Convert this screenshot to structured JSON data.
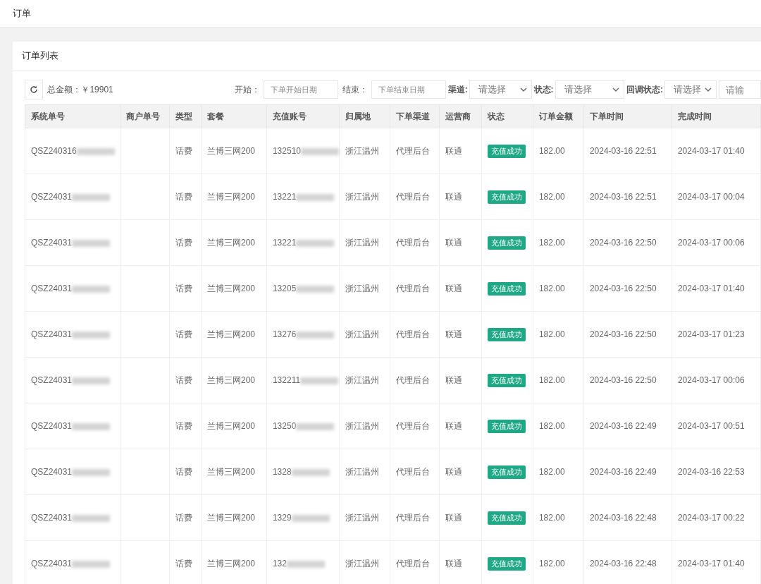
{
  "page_title": "订单",
  "card": {
    "title": "订单列表",
    "total": "总金额：￥19901",
    "filters": [
      {
        "kind": "date",
        "label": "开始：",
        "placeholder": "下单开始日期"
      },
      {
        "kind": "date",
        "label": "结束：",
        "placeholder": "下单结束日期"
      },
      {
        "kind": "select",
        "label": "渠道:",
        "value": "请选择"
      },
      {
        "kind": "select",
        "label": "状态:",
        "value": "请选择"
      },
      {
        "kind": "select",
        "label": "回调状态:",
        "value": "请选择"
      },
      {
        "kind": "input",
        "placeholder": "请输"
      }
    ]
  },
  "table": {
    "columns": [
      {
        "label": "系统单号",
        "kind": "masked"
      },
      {
        "label": "商户单号",
        "kind": "text"
      },
      {
        "label": "类型",
        "kind": "text"
      },
      {
        "label": "套餐",
        "kind": "text"
      },
      {
        "label": "充值账号",
        "kind": "masked"
      },
      {
        "label": "归属地",
        "kind": "text"
      },
      {
        "label": "下单渠道",
        "kind": "text"
      },
      {
        "label": "运营商",
        "kind": "text"
      },
      {
        "label": "状态",
        "kind": "badge"
      },
      {
        "label": "订单金额",
        "kind": "text"
      },
      {
        "label": "下单时间",
        "kind": "text"
      },
      {
        "label": "完成时间",
        "kind": "text"
      }
    ],
    "rows": [
      {
        "masked": true,
        "cells": [
          "QSZ240316",
          null,
          "话费",
          "兰博三网200",
          "132510",
          "浙江温州",
          "代理后台",
          "联通",
          "充值成功",
          "182.00",
          "2024-03-16 22:51",
          "2024-03-17 01:40"
        ]
      },
      {
        "masked": true,
        "cells": [
          "QSZ24031",
          null,
          "话费",
          "兰博三网200",
          "13221",
          "浙江温州",
          "代理后台",
          "联通",
          "充值成功",
          "182.00",
          "2024-03-16 22:51",
          "2024-03-17 00:04"
        ]
      },
      {
        "masked": true,
        "cells": [
          "QSZ24031",
          null,
          "话费",
          "兰博三网200",
          "13221",
          "浙江温州",
          "代理后台",
          "联通",
          "充值成功",
          "182.00",
          "2024-03-16 22:50",
          "2024-03-17 00:06"
        ]
      },
      {
        "masked": true,
        "cells": [
          "QSZ24031",
          null,
          "话费",
          "兰博三网200",
          "13205",
          "浙江温州",
          "代理后台",
          "联通",
          "充值成功",
          "182.00",
          "2024-03-16 22:50",
          "2024-03-17 01:40"
        ]
      },
      {
        "masked": true,
        "cells": [
          "QSZ24031",
          null,
          "话费",
          "兰博三网200",
          "13276",
          "浙江温州",
          "代理后台",
          "联通",
          "充值成功",
          "182.00",
          "2024-03-16 22:50",
          "2024-03-17 01:23"
        ]
      },
      {
        "masked": true,
        "cells": [
          "QSZ24031",
          null,
          "话费",
          "兰博三网200",
          "132211",
          "浙江温州",
          "代理后台",
          "联通",
          "充值成功",
          "182.00",
          "2024-03-16 22:50",
          "2024-03-17 00:06"
        ]
      },
      {
        "masked": true,
        "cells": [
          "QSZ24031",
          null,
          "话费",
          "兰博三网200",
          "13250",
          "浙江温州",
          "代理后台",
          "联通",
          "充值成功",
          "182.00",
          "2024-03-16 22:49",
          "2024-03-17 00:51"
        ]
      },
      {
        "masked": true,
        "cells": [
          "QSZ24031",
          null,
          "话费",
          "兰博三网200",
          "1328",
          "浙江温州",
          "代理后台",
          "联通",
          "充值成功",
          "182.00",
          "2024-03-16 22:49",
          "2024-03-16 22:53"
        ]
      },
      {
        "masked": true,
        "cells": [
          "QSZ24031",
          null,
          "话费",
          "兰博三网200",
          "1329",
          "浙江温州",
          "代理后台",
          "联通",
          "充值成功",
          "182.00",
          "2024-03-16 22:48",
          "2024-03-17 00:22"
        ]
      },
      {
        "masked": true,
        "cells": [
          "QSZ24031",
          null,
          "话费",
          "兰博三网200",
          "132",
          "浙江温州",
          "代理后台",
          "联通",
          "充值成功",
          "182.00",
          "2024-03-16 22:48",
          "2024-03-17 01:40"
        ]
      }
    ]
  }
}
